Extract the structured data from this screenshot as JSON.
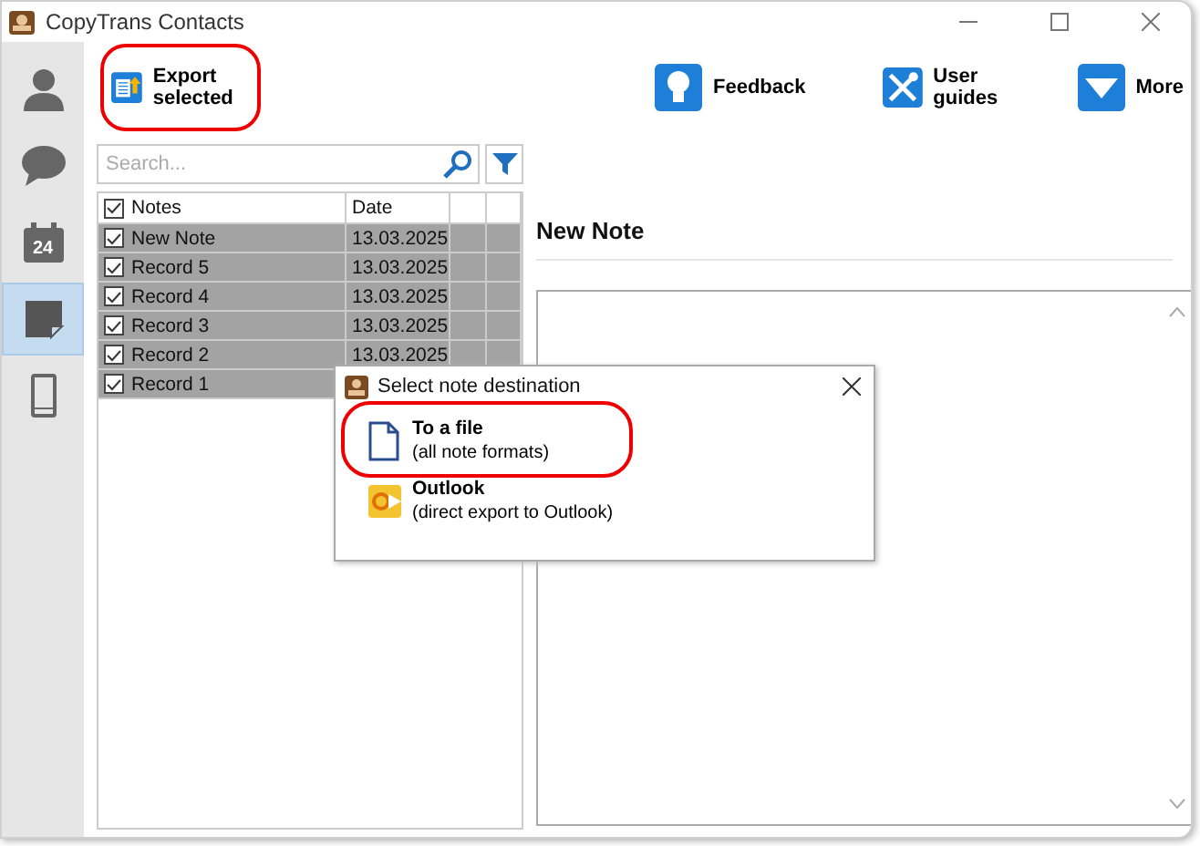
{
  "window": {
    "title": "CopyTrans Contacts"
  },
  "sidebar": {
    "items": [
      {
        "kind": "person",
        "selected": false
      },
      {
        "kind": "chat",
        "selected": false
      },
      {
        "kind": "calendar",
        "label": "24",
        "selected": false
      },
      {
        "kind": "note",
        "selected": true
      },
      {
        "kind": "phone",
        "selected": false
      }
    ]
  },
  "toolbar": {
    "buttons": [
      {
        "kind": "export",
        "label": "Export selected",
        "highlighted": true
      },
      {
        "kind": "bulb",
        "label": "Feedback",
        "highlighted": false
      },
      {
        "kind": "tools",
        "label": "User guides",
        "highlighted": false
      },
      {
        "kind": "more",
        "label": "More",
        "highlighted": false
      }
    ]
  },
  "search": {
    "placeholder": "Search..."
  },
  "table": {
    "header": {
      "label": "Notes",
      "checked": true
    },
    "columns": [
      "Date"
    ],
    "rows": [
      {
        "title": "New Note",
        "date": "13.03.2025",
        "checked": true,
        "selected": true
      },
      {
        "title": "Record 5",
        "date": "13.03.2025",
        "checked": true,
        "selected": true
      },
      {
        "title": "Record 4",
        "date": "13.03.2025",
        "checked": true,
        "selected": true
      },
      {
        "title": "Record 3",
        "date": "13.03.2025",
        "checked": true,
        "selected": true
      },
      {
        "title": "Record 2",
        "date": "13.03.2025",
        "checked": true,
        "selected": true
      },
      {
        "title": "Record 1",
        "checked": true,
        "selected": true
      }
    ]
  },
  "detail": {
    "title": "New Note"
  },
  "dialog": {
    "title": "Select note destination",
    "options": [
      {
        "kind": "file",
        "label": "To a file",
        "description": "(all note formats)",
        "highlighted": true
      },
      {
        "kind": "outlook",
        "label": "Outlook",
        "description": "(direct export to Outlook)",
        "highlighted": false
      }
    ]
  }
}
